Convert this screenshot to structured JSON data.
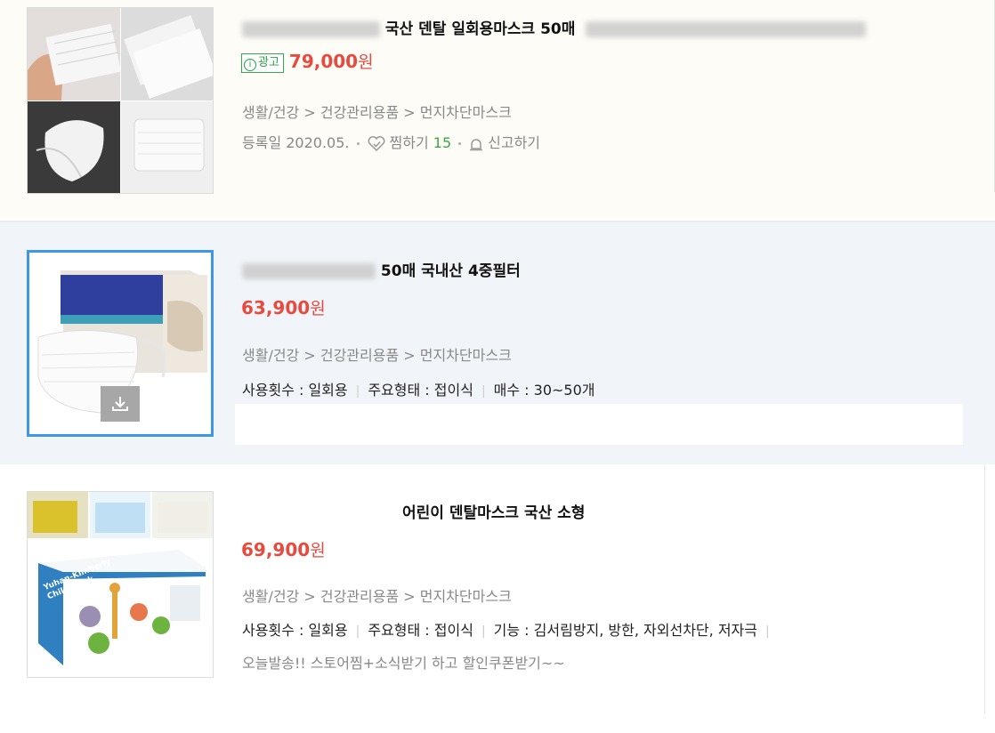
{
  "items": [
    {
      "title": "국산 덴탈 일회용마스크 50매",
      "ad_label": "광고",
      "price": "79,000",
      "price_unit": "원",
      "category": "생활/건강 > 건강관리용품 > 먼지차단마스크",
      "registered": "등록일 2020.05.",
      "zzim_label": "찜하기",
      "zzim_count": "15",
      "report_label": "신고하기"
    },
    {
      "title": "50매 국내산 4중필터",
      "price": "63,900",
      "price_unit": "원",
      "category": "생활/건강 > 건강관리용품 > 먼지차단마스크",
      "specs": [
        "사용횟수 : 일회용",
        "주요형태 : 접이식",
        "매수 : 30~50개"
      ]
    },
    {
      "title": "어린이 덴탈마스크 국산 소형",
      "price": "69,900",
      "price_unit": "원",
      "category": "생활/건강 > 건강관리용품 > 먼지차단마스크",
      "specs": [
        "사용횟수 : 일회용",
        "주요형태 : 접이식",
        "기능 : 김서림방지, 방한, 자외선차단, 저자극"
      ],
      "promo": "오늘발송!! 스토어찜+소식받기 하고 할인쿠폰받기~~",
      "image_text": [
        "Yuhan-Kimberly",
        "Child Mask"
      ]
    }
  ],
  "colors": {
    "price": "#e84a3d",
    "ad_green": "#2e9b4a",
    "selected_border": "#3d96e6"
  }
}
